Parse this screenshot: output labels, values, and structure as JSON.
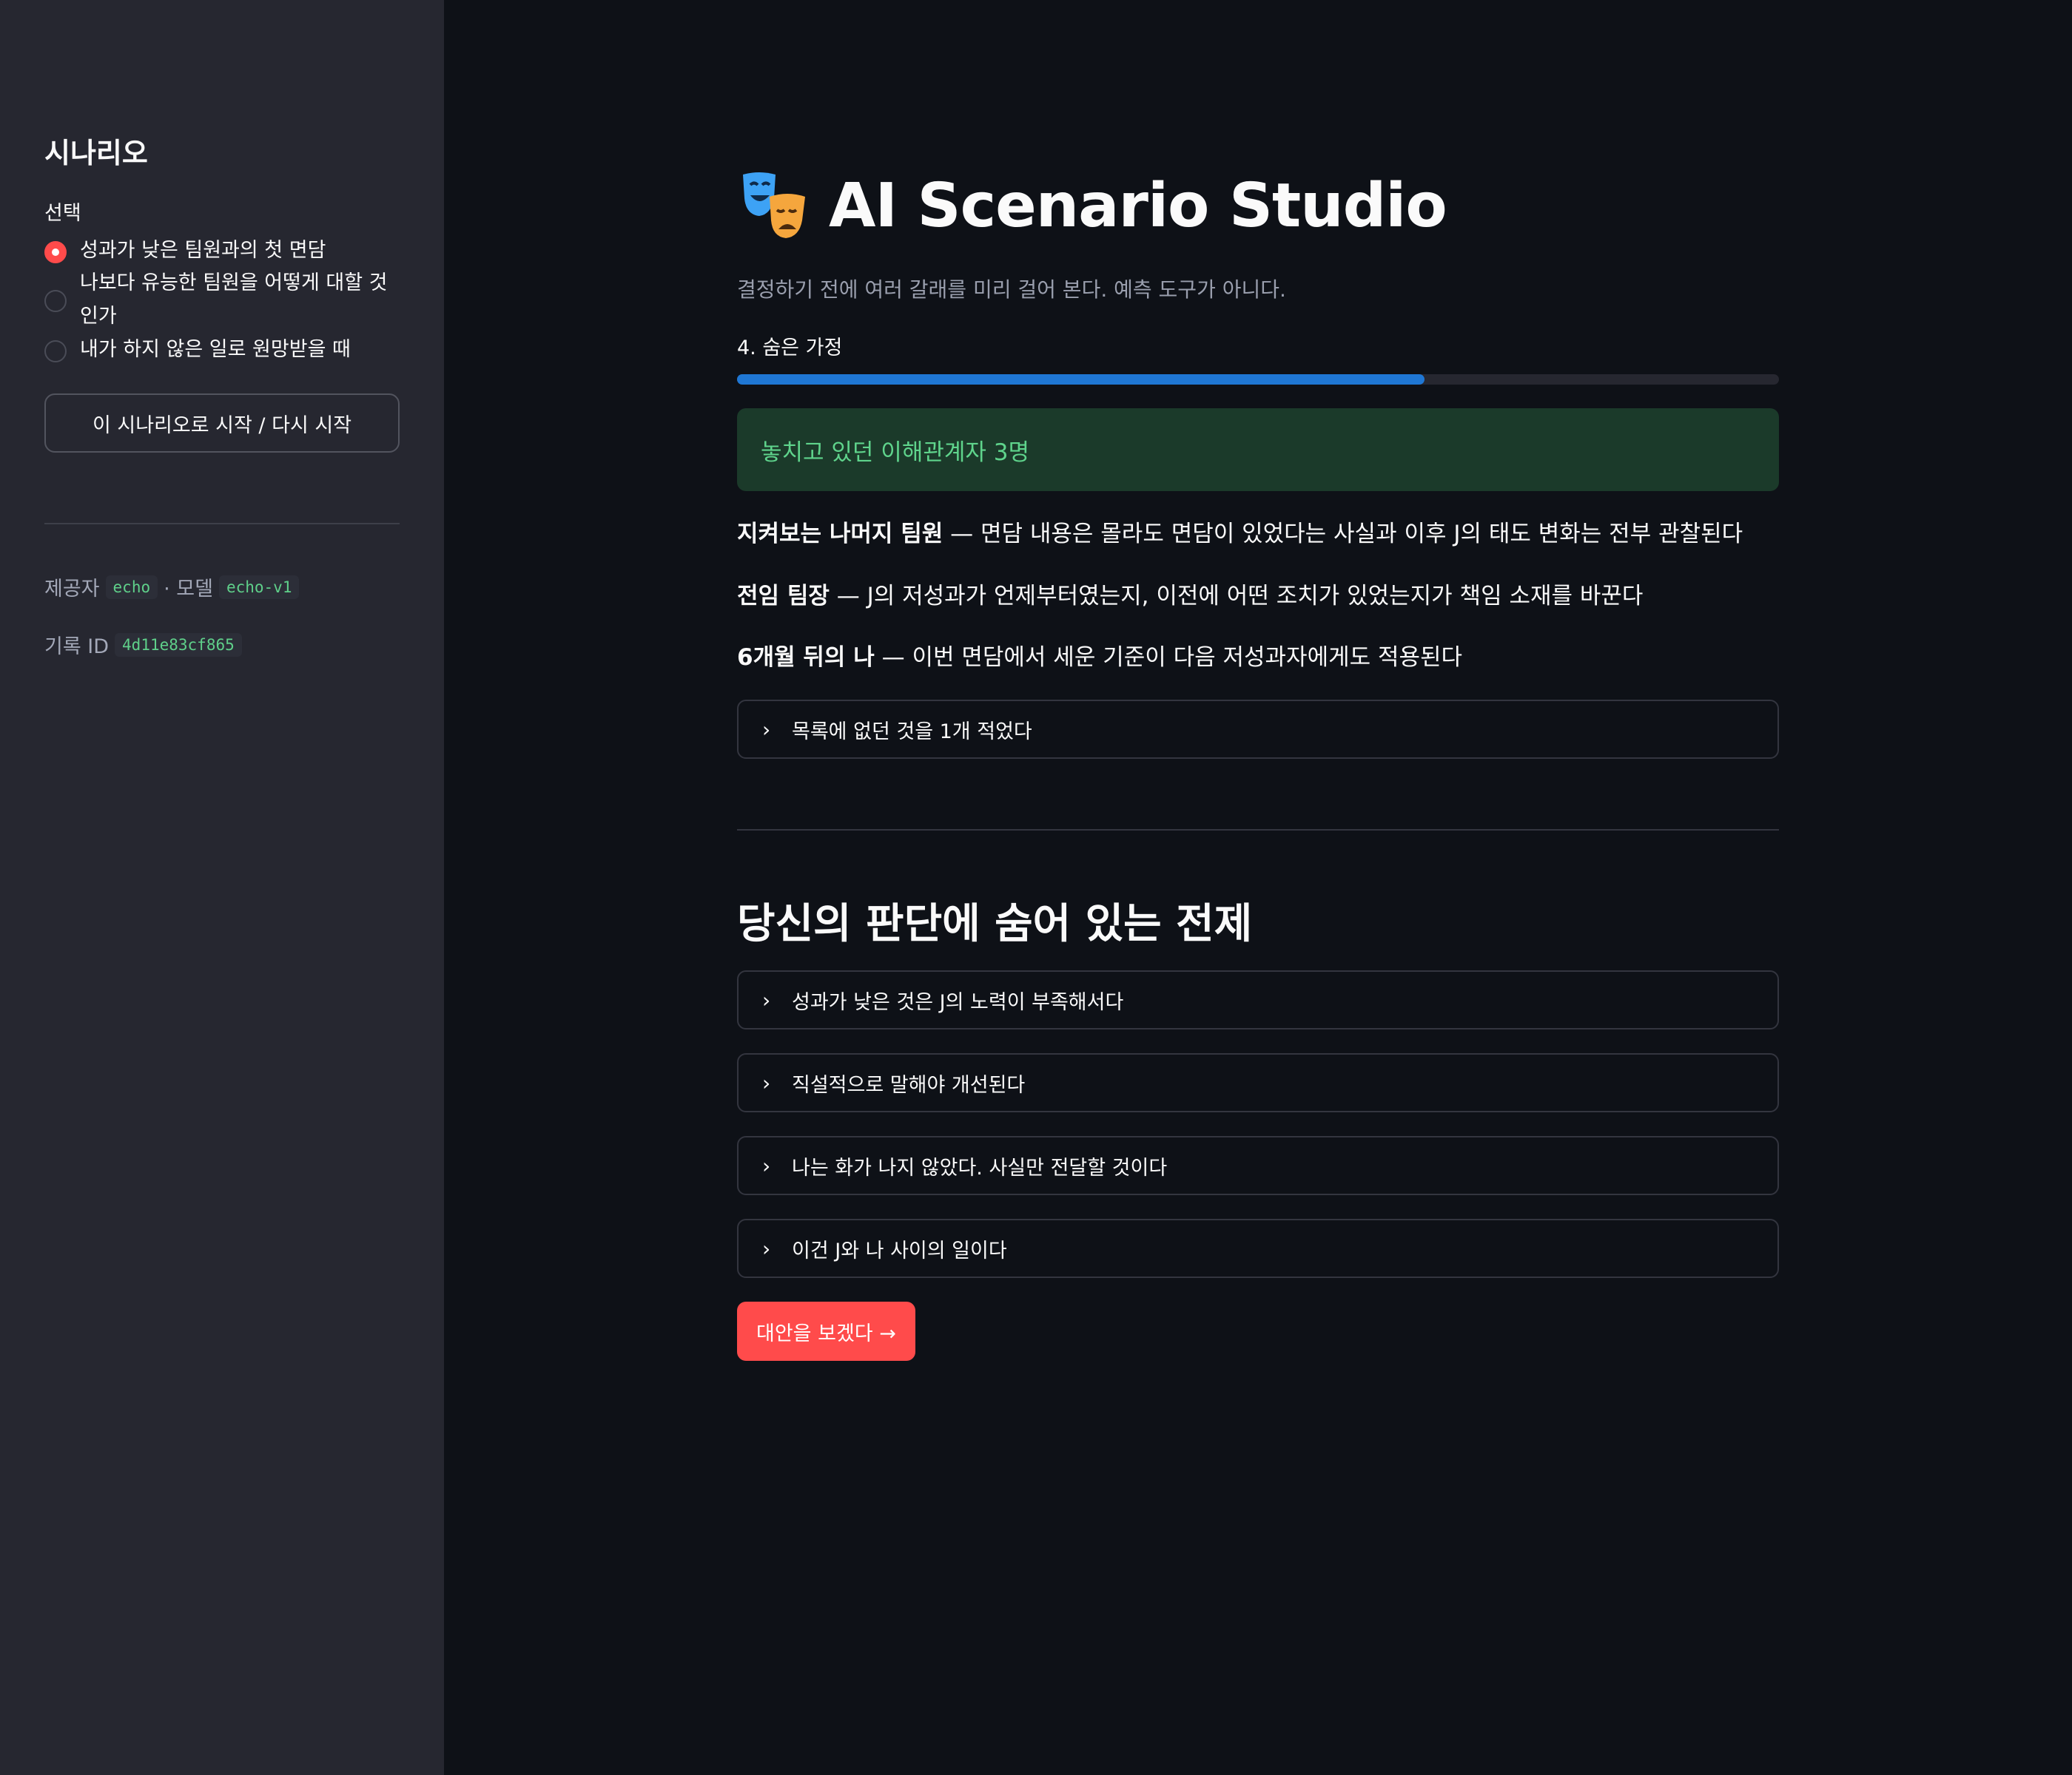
{
  "sidebar": {
    "title": "시나리오",
    "select_label": "선택",
    "options": [
      {
        "label": "성과가 낮은 팀원과의 첫 면담",
        "selected": true
      },
      {
        "label": "나보다 유능한 팀원을 어떻게 대할 것인가",
        "selected": false
      },
      {
        "label": "내가 하지 않은 일로 원망받을 때",
        "selected": false
      }
    ],
    "start_button": "이 시나리오로 시작 / 다시 시작",
    "provider_label": "제공자",
    "provider_value": "echo",
    "model_label": "· 모델",
    "model_value": "echo-v1",
    "record_label": "기록 ID",
    "record_value": "4d11e83cf865"
  },
  "main": {
    "title": "AI Scenario Studio",
    "title_icon": "performing-arts-masks-icon",
    "subtitle": "결정하기 전에 여러 갈래를 미리 걸어 본다. 예측 도구가 아니다.",
    "step_label": "4. 숨은 가정",
    "progress_fraction": 0.66,
    "alert": "놓치고 있던 이해관계자 3명",
    "stakeholders": [
      {
        "name": "지켜보는 나머지 팀원",
        "desc": " — 면담 내용은 몰라도 면담이 있었다는 사실과 이후 J의 태도 변화는 전부 관찰된다"
      },
      {
        "name": "전임 팀장",
        "desc": " — J의 저성과가 언제부터였는지, 이전에 어떤 조치가 있었는지가 책임 소재를 바꾼다"
      },
      {
        "name": "6개월 뒤의 나",
        "desc": " — 이번 면담에서 세운 기준이 다음 저성과자에게도 적용된다"
      }
    ],
    "missing_expander": "목록에 없던 것을 1개 적었다",
    "section_title": "당신의 판단에 숨어 있는 전제",
    "assumptions": [
      "성과가 낮은 것은 J의 노력이 부족해서다",
      "직설적으로 말해야 개선된다",
      "나는 화가 나지 않았다. 사실만 전달할 것이다",
      "이건 J와 나 사이의 일이다"
    ],
    "next_button": "대안을 보겠다 →",
    "accent_color": "#ff4b4b",
    "progress_color": "#1f77d4"
  }
}
